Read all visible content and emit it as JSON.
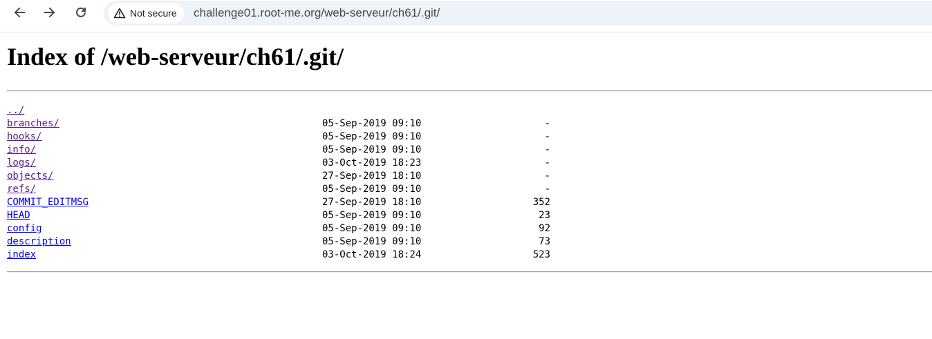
{
  "browser": {
    "security_label": "Not secure",
    "url": "challenge01.root-me.org/web-serveur/ch61/.git/"
  },
  "page": {
    "title": "Index of /web-serveur/ch61/.git/"
  },
  "listing": {
    "parent": {
      "name": "../"
    },
    "entries": [
      {
        "name": "branches/",
        "date": "05-Sep-2019 09:10",
        "size": "-",
        "visited": true
      },
      {
        "name": "hooks/",
        "date": "05-Sep-2019 09:10",
        "size": "-",
        "visited": true
      },
      {
        "name": "info/",
        "date": "05-Sep-2019 09:10",
        "size": "-",
        "visited": true
      },
      {
        "name": "logs/",
        "date": "03-Oct-2019 18:23",
        "size": "-",
        "visited": true
      },
      {
        "name": "objects/",
        "date": "27-Sep-2019 18:10",
        "size": "-",
        "visited": true
      },
      {
        "name": "refs/",
        "date": "05-Sep-2019 09:10",
        "size": "-",
        "visited": true
      },
      {
        "name": "COMMIT_EDITMSG",
        "date": "27-Sep-2019 18:10",
        "size": "352",
        "visited": false
      },
      {
        "name": "HEAD",
        "date": "05-Sep-2019 09:10",
        "size": "23",
        "visited": false
      },
      {
        "name": "config",
        "date": "05-Sep-2019 09:10",
        "size": "92",
        "visited": false
      },
      {
        "name": "description",
        "date": "05-Sep-2019 09:10",
        "size": "73",
        "visited": false
      },
      {
        "name": "index",
        "date": "03-Oct-2019 18:24",
        "size": "523",
        "visited": false
      }
    ]
  },
  "colors": {
    "link": "#0000ee",
    "visited_link": "#551a8b",
    "omnibox": "#eef2f9"
  }
}
